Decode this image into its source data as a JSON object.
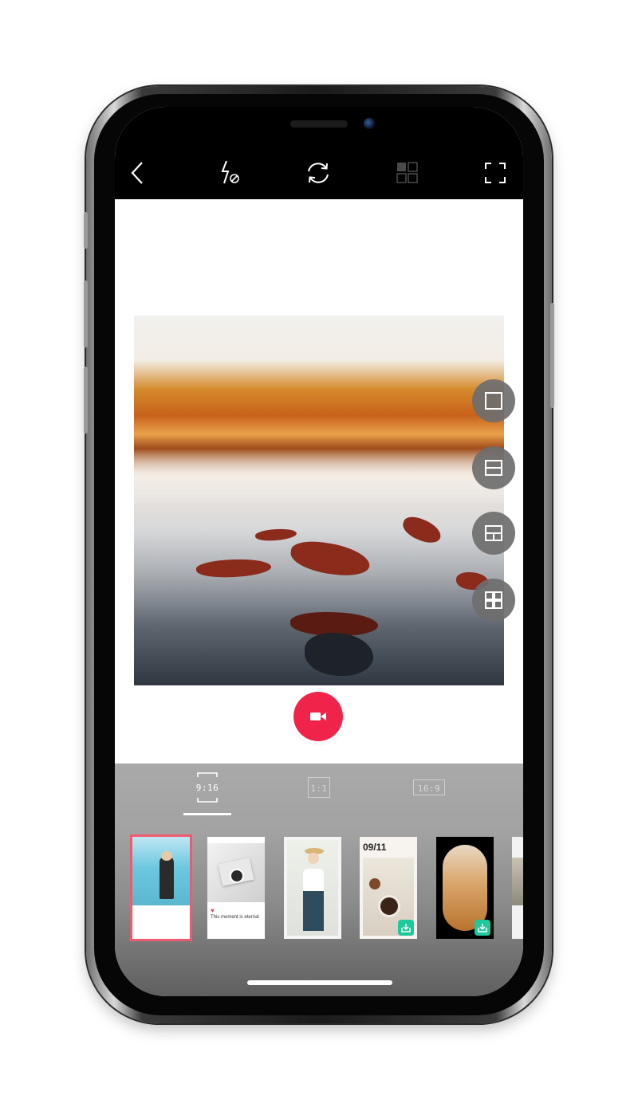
{
  "toolbar": {
    "back_icon": "chevron-left-icon",
    "flash_icon": "flash-off-icon",
    "switch_camera_icon": "camera-switch-icon",
    "grid_icon": "grid-icon",
    "fullscreen_icon": "fullscreen-icon"
  },
  "layout_options": [
    {
      "icon": "layout-single-icon"
    },
    {
      "icon": "layout-two-rows-icon"
    },
    {
      "icon": "layout-three-icon"
    },
    {
      "icon": "layout-four-icon"
    }
  ],
  "record": {
    "icon": "video-camera-icon",
    "color": "#f0234a"
  },
  "aspect_tabs": [
    {
      "label": "9:16",
      "selected": true
    },
    {
      "label": "1:1",
      "selected": false
    },
    {
      "label": "16:9",
      "selected": false
    }
  ],
  "templates": [
    {
      "name": "template-pool-girl",
      "selected": true
    },
    {
      "name": "template-coffee-book",
      "caption": "This moment is eternal"
    },
    {
      "name": "template-hat-girl"
    },
    {
      "name": "template-date",
      "date": "09/11",
      "downloadable": true
    },
    {
      "name": "template-desert-arch",
      "downloadable": true
    },
    {
      "name": "template-partial"
    }
  ],
  "colors": {
    "accent": "#f0234a",
    "selection": "#f05a6e",
    "download": "#1ec99b"
  }
}
